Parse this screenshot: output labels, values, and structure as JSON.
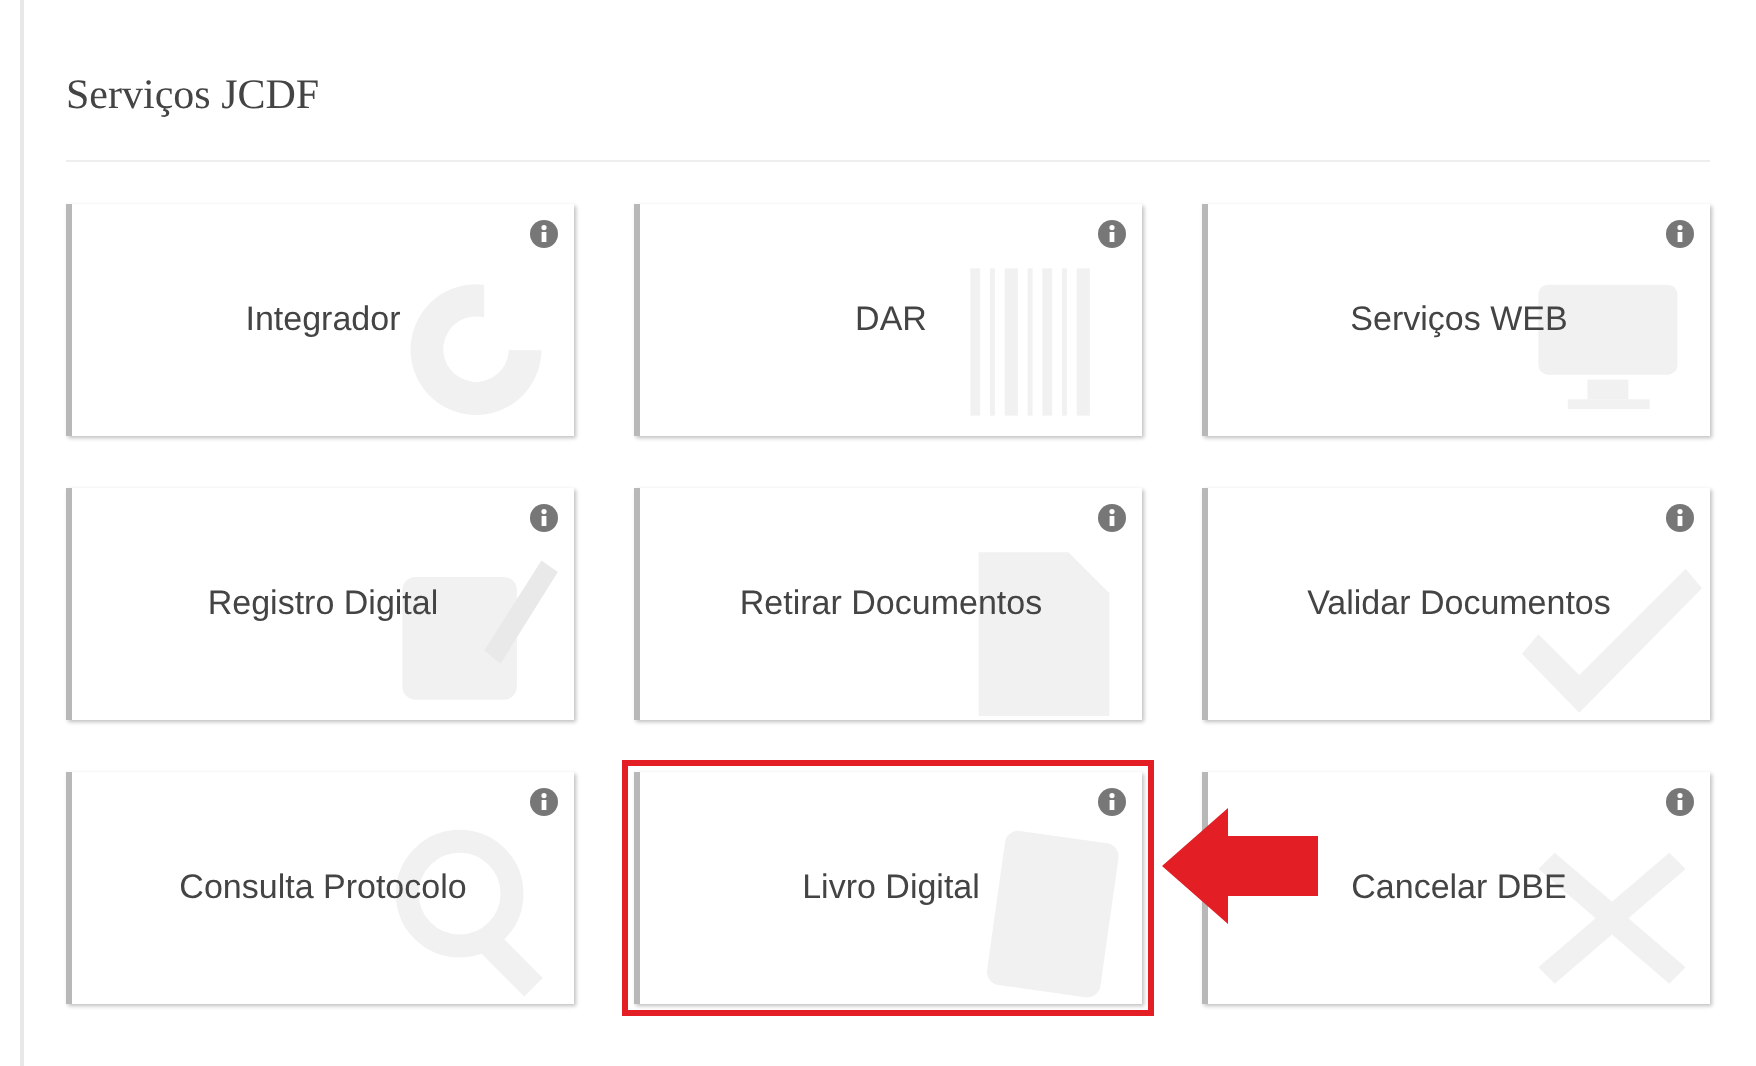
{
  "panel": {
    "title": "Serviços JCDF"
  },
  "tiles": [
    {
      "label": "Integrador",
      "highlighted": false
    },
    {
      "label": "DAR",
      "highlighted": false
    },
    {
      "label": "Serviços WEB",
      "highlighted": false
    },
    {
      "label": "Registro Digital",
      "highlighted": false
    },
    {
      "label": "Retirar Documentos",
      "highlighted": false
    },
    {
      "label": "Validar Documentos",
      "highlighted": false
    },
    {
      "label": "Consulta Protocolo",
      "highlighted": false
    },
    {
      "label": "Livro Digital",
      "highlighted": true
    },
    {
      "label": "Cancelar DBE",
      "highlighted": false
    }
  ]
}
